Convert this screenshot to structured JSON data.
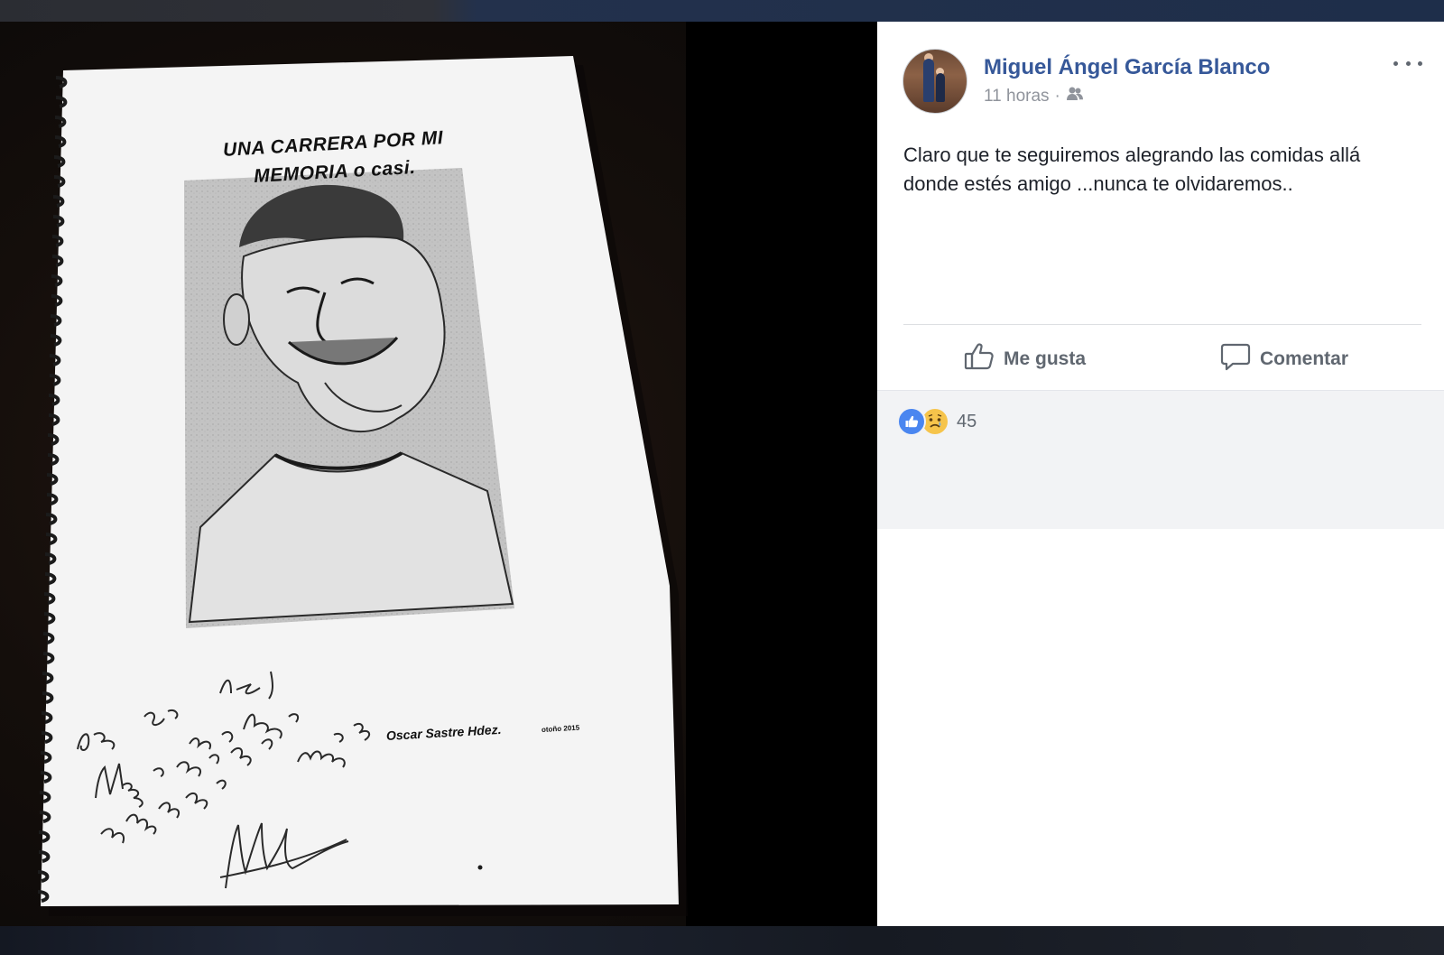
{
  "photo": {
    "document_title_line1": "UNA CARRERA POR MI",
    "document_title_line2": "MEMORIA o casi.",
    "document_author": "Oscar Sastre Hdez.",
    "document_season": "otoño 2015"
  },
  "post": {
    "author": "Miguel Ángel García Blanco",
    "timestamp": "11 horas",
    "audience_icon": "friends-icon",
    "text_line1": "Claro que te seguiremos alegrando las comidas allá",
    "text_line2": "donde estés amigo ...nunca te olvidaremos..",
    "actions": {
      "like_label": "Me gusta",
      "comment_label": "Comentar"
    },
    "reactions": {
      "types": [
        "like",
        "sad"
      ],
      "count": "45"
    }
  },
  "colors": {
    "link_blue": "#365899",
    "meta_gray": "#90949c",
    "action_gray": "#606770",
    "like_blue": "#4a86f0",
    "sad_yellow": "#f6c44b"
  }
}
